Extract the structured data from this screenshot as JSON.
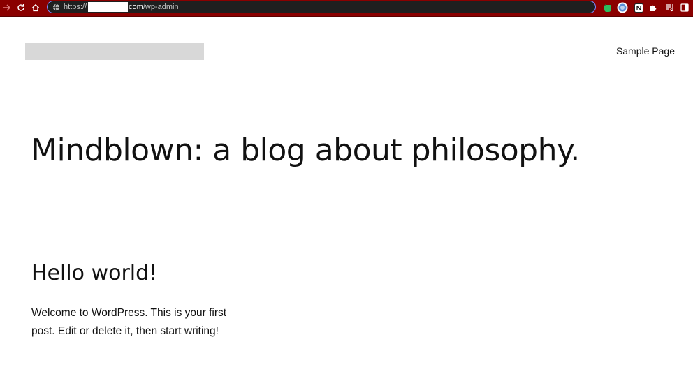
{
  "browser": {
    "url": {
      "scheme": "https://",
      "path_prefix": "com",
      "path": "/wp-admin"
    },
    "colors": {
      "toolbar": "#8a0000",
      "omnibox_border": "#7b8bff"
    }
  },
  "site": {
    "nav": {
      "sample_page": "Sample Page"
    },
    "tagline": "Mindblown: a blog about philosophy."
  },
  "post": {
    "title": "Hello world!",
    "excerpt": "Welcome to WordPress. This is your first post. Edit or delete it, then start writing!"
  }
}
